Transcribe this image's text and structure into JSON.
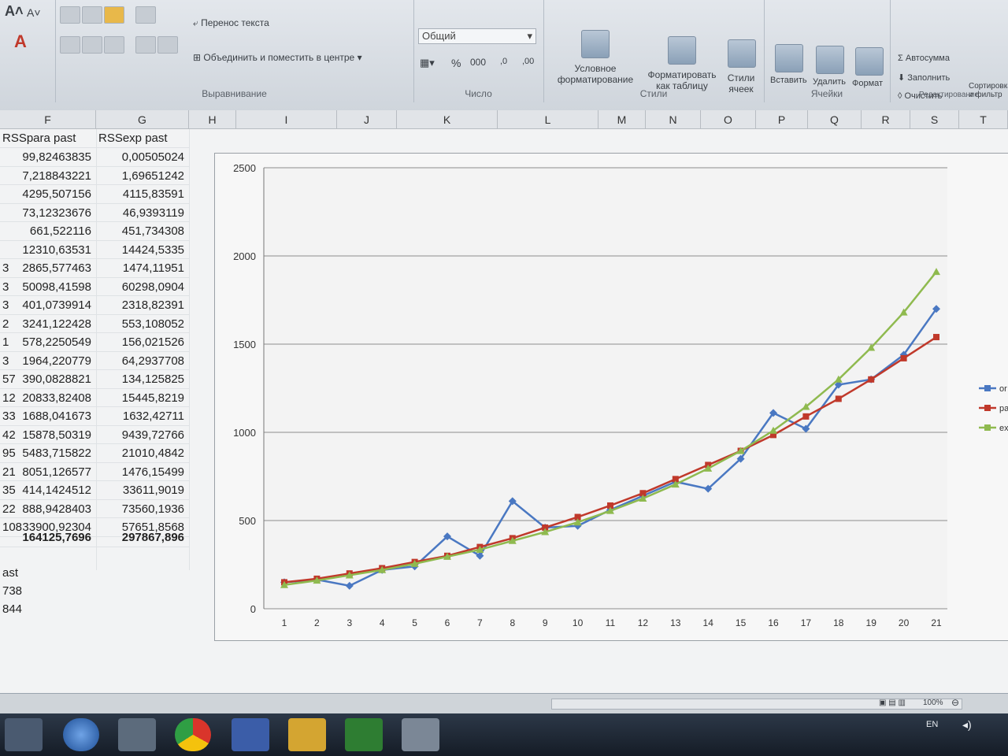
{
  "ribbon": {
    "wrap_text": "Перенос текста",
    "merge_center": "Объединить и поместить в центре",
    "alignment_group": "Выравнивание",
    "number_format": "Общий",
    "number_group": "Число",
    "conditional_format": "Условное форматирование",
    "format_table": "Форматировать как таблицу",
    "cell_styles": "Стили ячеек",
    "styles_group": "Стили",
    "insert": "Вставить",
    "delete": "Удалить",
    "format": "Формат",
    "cells_group": "Ячейки",
    "autosum": "Автосумма",
    "fill": "Заполнить",
    "clear": "Очистить",
    "sort_filter": "Сортировка и фильтр",
    "editing_group": "Редактирование"
  },
  "columns": [
    "F",
    "G",
    "H",
    "I",
    "J",
    "K",
    "L",
    "M",
    "N",
    "O",
    "P",
    "Q",
    "R",
    "S",
    "T"
  ],
  "table": {
    "headers": [
      "RSSpara past",
      "RSSexp past"
    ],
    "row_prefixes": [
      "",
      "",
      "",
      "",
      "",
      "",
      "3",
      "3",
      "3",
      "2",
      "1",
      "3",
      "57",
      "12",
      "33",
      "42",
      "95",
      "21",
      "35",
      "22",
      "108"
    ],
    "rss_para": [
      "99,82463835",
      "7,218843221",
      "4295,507156",
      "73,12323676",
      "661,522116",
      "12310,63531",
      "2865,577463",
      "50098,41598",
      "401,0739914",
      "3241,122428",
      "578,2250549",
      "1964,220779",
      "390,0828821",
      "20833,82408",
      "1688,041673",
      "15878,50319",
      "5483,715822",
      "8051,126577",
      "414,1424512",
      "888,9428403",
      "33900,92304"
    ],
    "rss_exp": [
      "0,00505024",
      "1,69651242",
      "4115,83591",
      "46,9393119",
      "451,734308",
      "14424,5335",
      "1474,11951",
      "60298,0904",
      "2318,82391",
      "553,108052",
      "156,021526",
      "64,2937708",
      "134,125825",
      "15445,8219",
      "1632,42711",
      "9439,72766",
      "21010,4842",
      "1476,15499",
      "33611,9019",
      "73560,1936",
      "57651,8568"
    ],
    "total_para": "164125,7696",
    "total_exp": "297867,896",
    "lower_labels": [
      "ast",
      "738",
      "844"
    ]
  },
  "chart_data": {
    "type": "line",
    "categories": [
      "1",
      "2",
      "3",
      "4",
      "5",
      "6",
      "7",
      "8",
      "9",
      "10",
      "11",
      "12",
      "13",
      "14",
      "15",
      "16",
      "17",
      "18",
      "19",
      "20",
      "21"
    ],
    "ylim": [
      0,
      2500
    ],
    "yticks": [
      "0",
      "500",
      "1000",
      "1500",
      "2000",
      "2500"
    ],
    "grid": true,
    "legend_position": "right",
    "series": [
      {
        "name": "or",
        "color": "#4a78c2",
        "marker": "diamond",
        "values": [
          150,
          165,
          130,
          220,
          240,
          410,
          300,
          610,
          460,
          470,
          560,
          640,
          720,
          680,
          850,
          1110,
          1020,
          1270,
          1300,
          1440,
          1700
        ]
      },
      {
        "name": "pa",
        "color": "#c0392b",
        "marker": "square",
        "values": [
          150,
          170,
          200,
          230,
          265,
          300,
          350,
          400,
          460,
          520,
          585,
          655,
          735,
          815,
          895,
          985,
          1090,
          1190,
          1300,
          1420,
          1540
        ]
      },
      {
        "name": "exp",
        "color": "#8fba4f",
        "marker": "triangle",
        "values": [
          135,
          160,
          190,
          220,
          255,
          295,
          335,
          385,
          435,
          490,
          555,
          625,
          705,
          795,
          895,
          1010,
          1145,
          1300,
          1480,
          1680,
          1910
        ]
      }
    ]
  },
  "status": {
    "zoom": "100%",
    "lang": "EN"
  }
}
